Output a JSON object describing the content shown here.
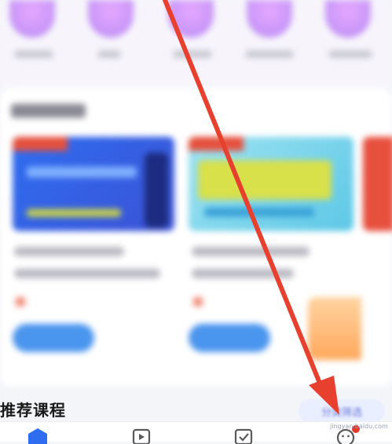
{
  "recommend": {
    "title": "推荐课程",
    "more_label": "分类筛选"
  },
  "tabs": [
    {
      "icon": "home-icon",
      "active": true
    },
    {
      "icon": "play-icon",
      "active": false
    },
    {
      "icon": "check-icon",
      "active": false
    },
    {
      "icon": "smiley-icon",
      "active": false,
      "badge": true
    }
  ],
  "watermark": "jingyan.baidu.com",
  "colors": {
    "accent_blue": "#2f6df0",
    "annotation_red": "#e8402f",
    "badge_red": "#e23a2a"
  }
}
